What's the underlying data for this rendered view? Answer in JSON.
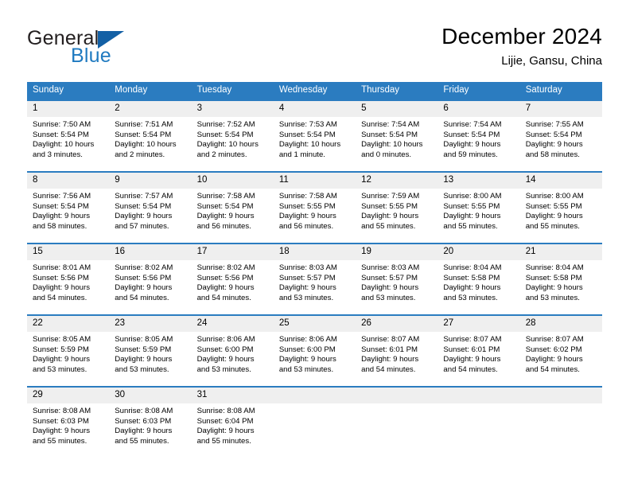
{
  "logo": {
    "word_one": "General",
    "word_two": "Blue",
    "triangle_icon": "triangle-icon",
    "brand_blue": "#1360a5",
    "text_blue": "#1f7ac0"
  },
  "header": {
    "title": "December 2024",
    "subtitle": "Lijie, Gansu, China"
  },
  "theme": {
    "header_blue": "#2b7cc0",
    "daynum_band": "#efefef",
    "cell_background": "#ffffff"
  },
  "calendar": {
    "weekday_headers": [
      "Sunday",
      "Monday",
      "Tuesday",
      "Wednesday",
      "Thursday",
      "Friday",
      "Saturday"
    ],
    "weeks": [
      [
        {
          "day": "1",
          "sunrise": "Sunrise: 7:50 AM",
          "sunset": "Sunset: 5:54 PM",
          "daylight_line1": "Daylight: 10 hours",
          "daylight_line2": "and 3 minutes."
        },
        {
          "day": "2",
          "sunrise": "Sunrise: 7:51 AM",
          "sunset": "Sunset: 5:54 PM",
          "daylight_line1": "Daylight: 10 hours",
          "daylight_line2": "and 2 minutes."
        },
        {
          "day": "3",
          "sunrise": "Sunrise: 7:52 AM",
          "sunset": "Sunset: 5:54 PM",
          "daylight_line1": "Daylight: 10 hours",
          "daylight_line2": "and 2 minutes."
        },
        {
          "day": "4",
          "sunrise": "Sunrise: 7:53 AM",
          "sunset": "Sunset: 5:54 PM",
          "daylight_line1": "Daylight: 10 hours",
          "daylight_line2": "and 1 minute."
        },
        {
          "day": "5",
          "sunrise": "Sunrise: 7:54 AM",
          "sunset": "Sunset: 5:54 PM",
          "daylight_line1": "Daylight: 10 hours",
          "daylight_line2": "and 0 minutes."
        },
        {
          "day": "6",
          "sunrise": "Sunrise: 7:54 AM",
          "sunset": "Sunset: 5:54 PM",
          "daylight_line1": "Daylight: 9 hours",
          "daylight_line2": "and 59 minutes."
        },
        {
          "day": "7",
          "sunrise": "Sunrise: 7:55 AM",
          "sunset": "Sunset: 5:54 PM",
          "daylight_line1": "Daylight: 9 hours",
          "daylight_line2": "and 58 minutes."
        }
      ],
      [
        {
          "day": "8",
          "sunrise": "Sunrise: 7:56 AM",
          "sunset": "Sunset: 5:54 PM",
          "daylight_line1": "Daylight: 9 hours",
          "daylight_line2": "and 58 minutes."
        },
        {
          "day": "9",
          "sunrise": "Sunrise: 7:57 AM",
          "sunset": "Sunset: 5:54 PM",
          "daylight_line1": "Daylight: 9 hours",
          "daylight_line2": "and 57 minutes."
        },
        {
          "day": "10",
          "sunrise": "Sunrise: 7:58 AM",
          "sunset": "Sunset: 5:54 PM",
          "daylight_line1": "Daylight: 9 hours",
          "daylight_line2": "and 56 minutes."
        },
        {
          "day": "11",
          "sunrise": "Sunrise: 7:58 AM",
          "sunset": "Sunset: 5:55 PM",
          "daylight_line1": "Daylight: 9 hours",
          "daylight_line2": "and 56 minutes."
        },
        {
          "day": "12",
          "sunrise": "Sunrise: 7:59 AM",
          "sunset": "Sunset: 5:55 PM",
          "daylight_line1": "Daylight: 9 hours",
          "daylight_line2": "and 55 minutes."
        },
        {
          "day": "13",
          "sunrise": "Sunrise: 8:00 AM",
          "sunset": "Sunset: 5:55 PM",
          "daylight_line1": "Daylight: 9 hours",
          "daylight_line2": "and 55 minutes."
        },
        {
          "day": "14",
          "sunrise": "Sunrise: 8:00 AM",
          "sunset": "Sunset: 5:55 PM",
          "daylight_line1": "Daylight: 9 hours",
          "daylight_line2": "and 55 minutes."
        }
      ],
      [
        {
          "day": "15",
          "sunrise": "Sunrise: 8:01 AM",
          "sunset": "Sunset: 5:56 PM",
          "daylight_line1": "Daylight: 9 hours",
          "daylight_line2": "and 54 minutes."
        },
        {
          "day": "16",
          "sunrise": "Sunrise: 8:02 AM",
          "sunset": "Sunset: 5:56 PM",
          "daylight_line1": "Daylight: 9 hours",
          "daylight_line2": "and 54 minutes."
        },
        {
          "day": "17",
          "sunrise": "Sunrise: 8:02 AM",
          "sunset": "Sunset: 5:56 PM",
          "daylight_line1": "Daylight: 9 hours",
          "daylight_line2": "and 54 minutes."
        },
        {
          "day": "18",
          "sunrise": "Sunrise: 8:03 AM",
          "sunset": "Sunset: 5:57 PM",
          "daylight_line1": "Daylight: 9 hours",
          "daylight_line2": "and 53 minutes."
        },
        {
          "day": "19",
          "sunrise": "Sunrise: 8:03 AM",
          "sunset": "Sunset: 5:57 PM",
          "daylight_line1": "Daylight: 9 hours",
          "daylight_line2": "and 53 minutes."
        },
        {
          "day": "20",
          "sunrise": "Sunrise: 8:04 AM",
          "sunset": "Sunset: 5:58 PM",
          "daylight_line1": "Daylight: 9 hours",
          "daylight_line2": "and 53 minutes."
        },
        {
          "day": "21",
          "sunrise": "Sunrise: 8:04 AM",
          "sunset": "Sunset: 5:58 PM",
          "daylight_line1": "Daylight: 9 hours",
          "daylight_line2": "and 53 minutes."
        }
      ],
      [
        {
          "day": "22",
          "sunrise": "Sunrise: 8:05 AM",
          "sunset": "Sunset: 5:59 PM",
          "daylight_line1": "Daylight: 9 hours",
          "daylight_line2": "and 53 minutes."
        },
        {
          "day": "23",
          "sunrise": "Sunrise: 8:05 AM",
          "sunset": "Sunset: 5:59 PM",
          "daylight_line1": "Daylight: 9 hours",
          "daylight_line2": "and 53 minutes."
        },
        {
          "day": "24",
          "sunrise": "Sunrise: 8:06 AM",
          "sunset": "Sunset: 6:00 PM",
          "daylight_line1": "Daylight: 9 hours",
          "daylight_line2": "and 53 minutes."
        },
        {
          "day": "25",
          "sunrise": "Sunrise: 8:06 AM",
          "sunset": "Sunset: 6:00 PM",
          "daylight_line1": "Daylight: 9 hours",
          "daylight_line2": "and 53 minutes."
        },
        {
          "day": "26",
          "sunrise": "Sunrise: 8:07 AM",
          "sunset": "Sunset: 6:01 PM",
          "daylight_line1": "Daylight: 9 hours",
          "daylight_line2": "and 54 minutes."
        },
        {
          "day": "27",
          "sunrise": "Sunrise: 8:07 AM",
          "sunset": "Sunset: 6:01 PM",
          "daylight_line1": "Daylight: 9 hours",
          "daylight_line2": "and 54 minutes."
        },
        {
          "day": "28",
          "sunrise": "Sunrise: 8:07 AM",
          "sunset": "Sunset: 6:02 PM",
          "daylight_line1": "Daylight: 9 hours",
          "daylight_line2": "and 54 minutes."
        }
      ],
      [
        {
          "day": "29",
          "sunrise": "Sunrise: 8:08 AM",
          "sunset": "Sunset: 6:03 PM",
          "daylight_line1": "Daylight: 9 hours",
          "daylight_line2": "and 55 minutes."
        },
        {
          "day": "30",
          "sunrise": "Sunrise: 8:08 AM",
          "sunset": "Sunset: 6:03 PM",
          "daylight_line1": "Daylight: 9 hours",
          "daylight_line2": "and 55 minutes."
        },
        {
          "day": "31",
          "sunrise": "Sunrise: 8:08 AM",
          "sunset": "Sunset: 6:04 PM",
          "daylight_line1": "Daylight: 9 hours",
          "daylight_line2": "and 55 minutes."
        },
        {
          "day": "",
          "sunrise": "",
          "sunset": "",
          "daylight_line1": "",
          "daylight_line2": ""
        },
        {
          "day": "",
          "sunrise": "",
          "sunset": "",
          "daylight_line1": "",
          "daylight_line2": ""
        },
        {
          "day": "",
          "sunrise": "",
          "sunset": "",
          "daylight_line1": "",
          "daylight_line2": ""
        },
        {
          "day": "",
          "sunrise": "",
          "sunset": "",
          "daylight_line1": "",
          "daylight_line2": ""
        }
      ]
    ]
  }
}
